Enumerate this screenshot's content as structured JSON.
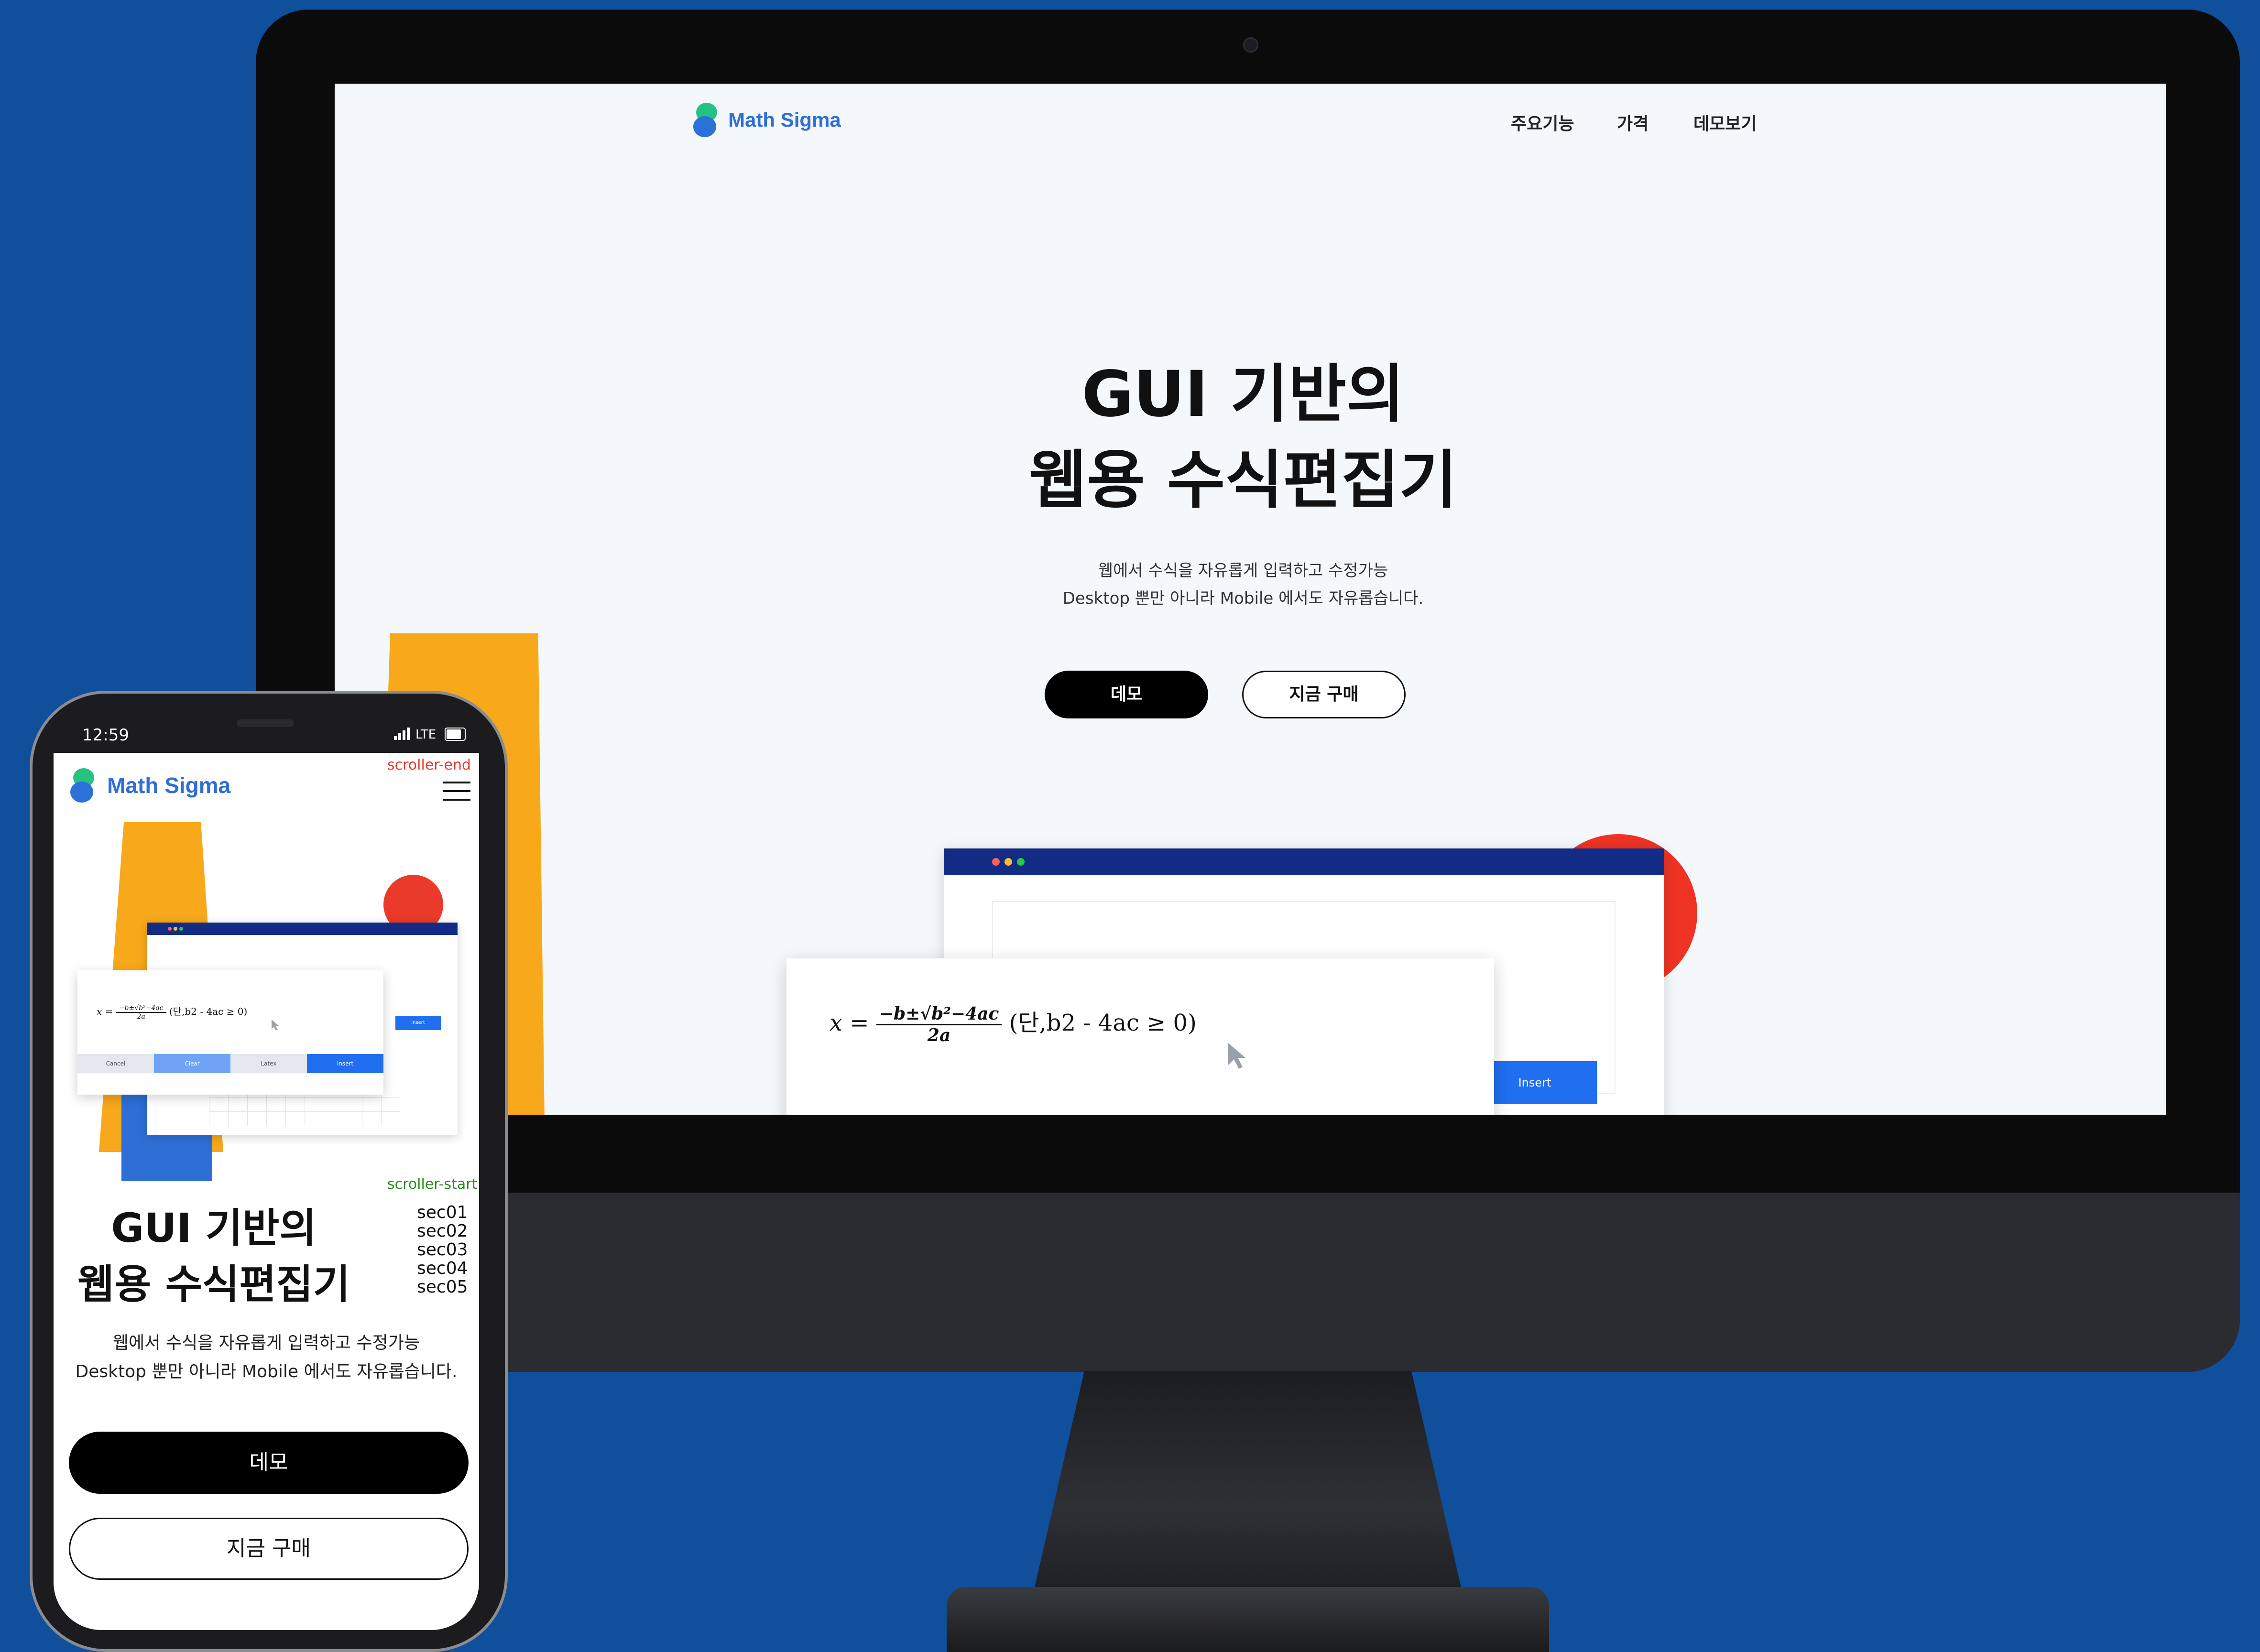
{
  "desktop": {
    "logo": "Math Sigma",
    "nav": [
      "주요기능",
      "가격",
      "데모보기"
    ],
    "title_line1": "GUI 기반의",
    "title_line2": "웹용 수식편집기",
    "subtitle_line1": "웹에서 수식을 자유롭게 입력하고 수정가능",
    "subtitle_line2": "Desktop 뿐만 아니라 Mobile 에서도 자유롭습니다.",
    "demo_button": "데모",
    "buy_button": "지금 구매",
    "insert_button": "Insert",
    "formula": {
      "lhs": "x =",
      "numerator": "−b±√b²−4ac",
      "denominator": "2a",
      "condition": "(단,b2 - 4ac ≥ 0)"
    }
  },
  "phone": {
    "time": "12:59",
    "network": "LTE",
    "logo": "Math Sigma",
    "scroller_end": "scroller-end",
    "scroller_start": "scroller-start",
    "sections": [
      "sec01",
      "sec02",
      "sec03",
      "sec04",
      "sec05"
    ],
    "title_line1": "GUI 기반의",
    "title_line2": "웹용 수식편집기",
    "subtitle_line1": "웹에서 수식을 자유롭게 입력하고 수정가능",
    "subtitle_line2": "Desktop 뿐만 아니라 Mobile 에서도 자유롭습니다.",
    "demo_button": "데모",
    "buy_button": "지금 구매",
    "mini_tabs": [
      "Cancel",
      "Clear",
      "Latex",
      "Insert"
    ],
    "insert_button": "Insert"
  },
  "colors": {
    "background": "#0f4f9c",
    "brand": "#2f6ed6",
    "accent_yellow": "#f7a81b",
    "accent_red": "#ee3324",
    "accent_blue": "#1f6ff0"
  }
}
